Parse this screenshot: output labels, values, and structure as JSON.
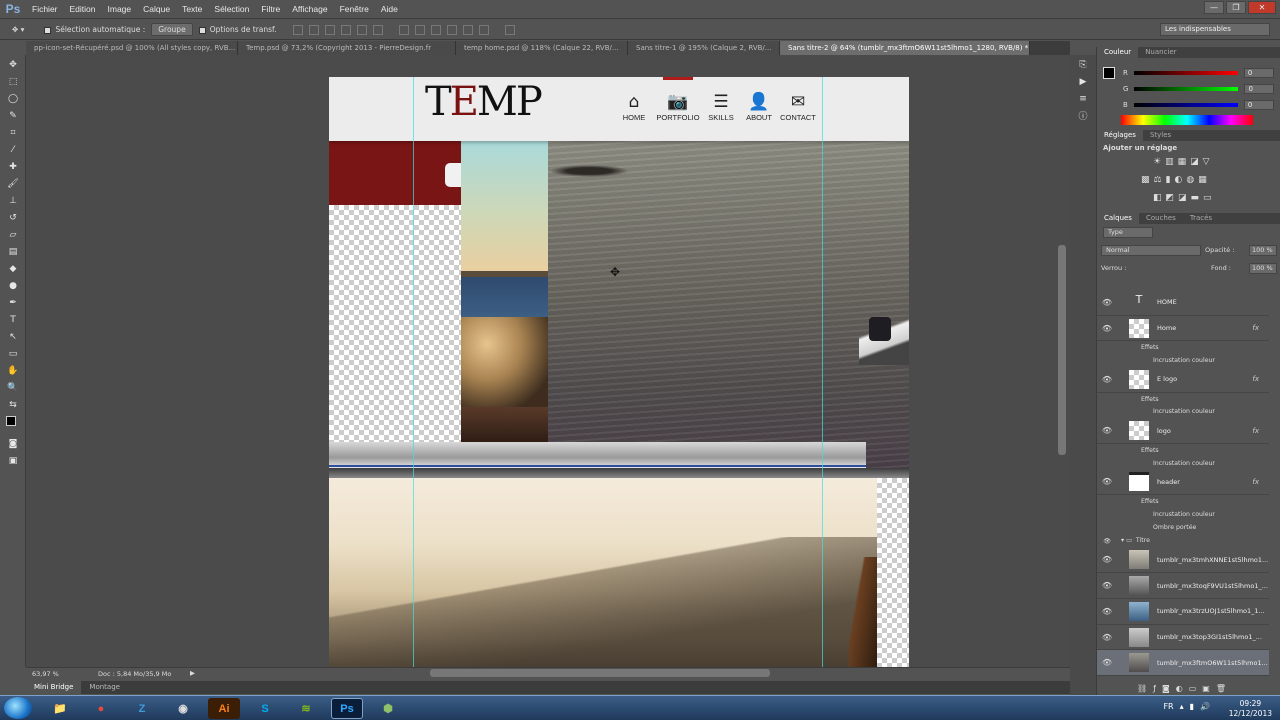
{
  "menu": {
    "logo": "Ps",
    "items": [
      "Fichier",
      "Edition",
      "Image",
      "Calque",
      "Texte",
      "Sélection",
      "Filtre",
      "Affichage",
      "Fenêtre",
      "Aide"
    ]
  },
  "options": {
    "auto_select": "Sélection automatique :",
    "group": "Groupe",
    "transform": "Options de transf."
  },
  "workspace": "Les indispensables",
  "tabs": [
    {
      "label": "pp-icon-set-Récupéré.psd @ 100% (All styles copy, RVB...",
      "active": false
    },
    {
      "label": "Temp.psd @ 73,2% (Copyright 2013 - PierreDesign.fr",
      "active": false
    },
    {
      "label": "temp home.psd @ 118% (Calque 22, RVB/...",
      "active": false
    },
    {
      "label": "Sans titre-1 @ 195% (Calque 2, RVB/...",
      "active": false
    },
    {
      "label": "Sans titre-2 @ 64% (tumblr_mx3ftmO6W11st5lhmo1_1280, RVB/8) *",
      "active": true
    }
  ],
  "site": {
    "logo_prefix": "T",
    "logo_e": "E",
    "logo_suffix": "MP",
    "nav": [
      {
        "label": "HOME",
        "icon": "home-icon",
        "glyph": "⌂"
      },
      {
        "label": "PORTFOLIO",
        "icon": "camera-icon",
        "glyph": "📷"
      },
      {
        "label": "SKILLS",
        "icon": "list-icon",
        "glyph": "☰"
      },
      {
        "label": "ABOUT",
        "icon": "person-icon",
        "glyph": "👤"
      },
      {
        "label": "CONTACT",
        "icon": "envelope-icon",
        "glyph": "✉"
      }
    ]
  },
  "status": {
    "zoom": "63,97 %",
    "doc": "Doc : 5,84 Mo/35,9 Mo"
  },
  "minibridge": {
    "tab1": "Mini Bridge",
    "tab2": "Montage"
  },
  "color_panel": {
    "tab1": "Couleur",
    "tab2": "Nuancier",
    "r": "R",
    "g": "G",
    "b": "B",
    "r_val": "0",
    "g_val": "0",
    "b_val": "0"
  },
  "adjust_panel": {
    "tab1": "Réglages",
    "tab2": "Styles",
    "title": "Ajouter un réglage"
  },
  "layers_panel": {
    "tabs": [
      "Calques",
      "Couches",
      "Tracés"
    ],
    "filter": "Type",
    "blend": "Normal",
    "opacity_label": "Opacité :",
    "opacity": "100 %",
    "lock_label": "Verrou :",
    "fill_label": "Fond :",
    "fill": "100 %",
    "rows": [
      {
        "kind": "text",
        "name": "HOME"
      },
      {
        "kind": "layer",
        "name": "Home",
        "fx": true,
        "effects": [
          "Incrustation couleur"
        ]
      },
      {
        "kind": "layer",
        "name": "E logo",
        "fx": true,
        "effects": [
          "Incrustation couleur"
        ]
      },
      {
        "kind": "layer",
        "name": "logo",
        "fx": true,
        "effects": [
          "Incrustation couleur"
        ]
      },
      {
        "kind": "layer",
        "name": "header",
        "fx": true,
        "effects": [
          "Incrustation couleur",
          "Ombre portée"
        ]
      },
      {
        "kind": "group",
        "name": "Titre"
      },
      {
        "kind": "image",
        "name": "tumblr_mx3tmhXNNE1st5lhmo1..."
      },
      {
        "kind": "image",
        "name": "tumblr_mx3toqF9VU1st5lhmo1_..."
      },
      {
        "kind": "image",
        "name": "tumblr_mx3trzUOJ1st5lhmo1_1..."
      },
      {
        "kind": "image",
        "name": "tumblr_mx3top3GI1st5lhmo1_..."
      },
      {
        "kind": "image",
        "name": "tumblr_mx3ftmO6W11st5lhmo1..."
      }
    ],
    "effects_label": "Effets"
  },
  "taskbar": {
    "time": "09:29",
    "date": "12/12/2013",
    "lang": "FR",
    "apps": [
      {
        "name": "explorer-app",
        "glyph": "📁",
        "color": "#e6b84a"
      },
      {
        "name": "chrome-app",
        "glyph": "●",
        "color": "#e34a3a"
      },
      {
        "name": "app-3",
        "glyph": "Z",
        "color": "#3c9bd9"
      },
      {
        "name": "camera-app",
        "glyph": "◉",
        "color": "#333333"
      },
      {
        "name": "illustrator-app",
        "glyph": "Ai",
        "color": "#ff7f18"
      },
      {
        "name": "skype-app",
        "glyph": "S",
        "color": "#00aff0"
      },
      {
        "name": "spotify-app",
        "glyph": "≋",
        "color": "#81b71a"
      },
      {
        "name": "photoshop-app",
        "glyph": "Ps",
        "color": "#31a8ff"
      },
      {
        "name": "app-9",
        "glyph": "⬢",
        "color": "#5a8a3a"
      }
    ]
  }
}
